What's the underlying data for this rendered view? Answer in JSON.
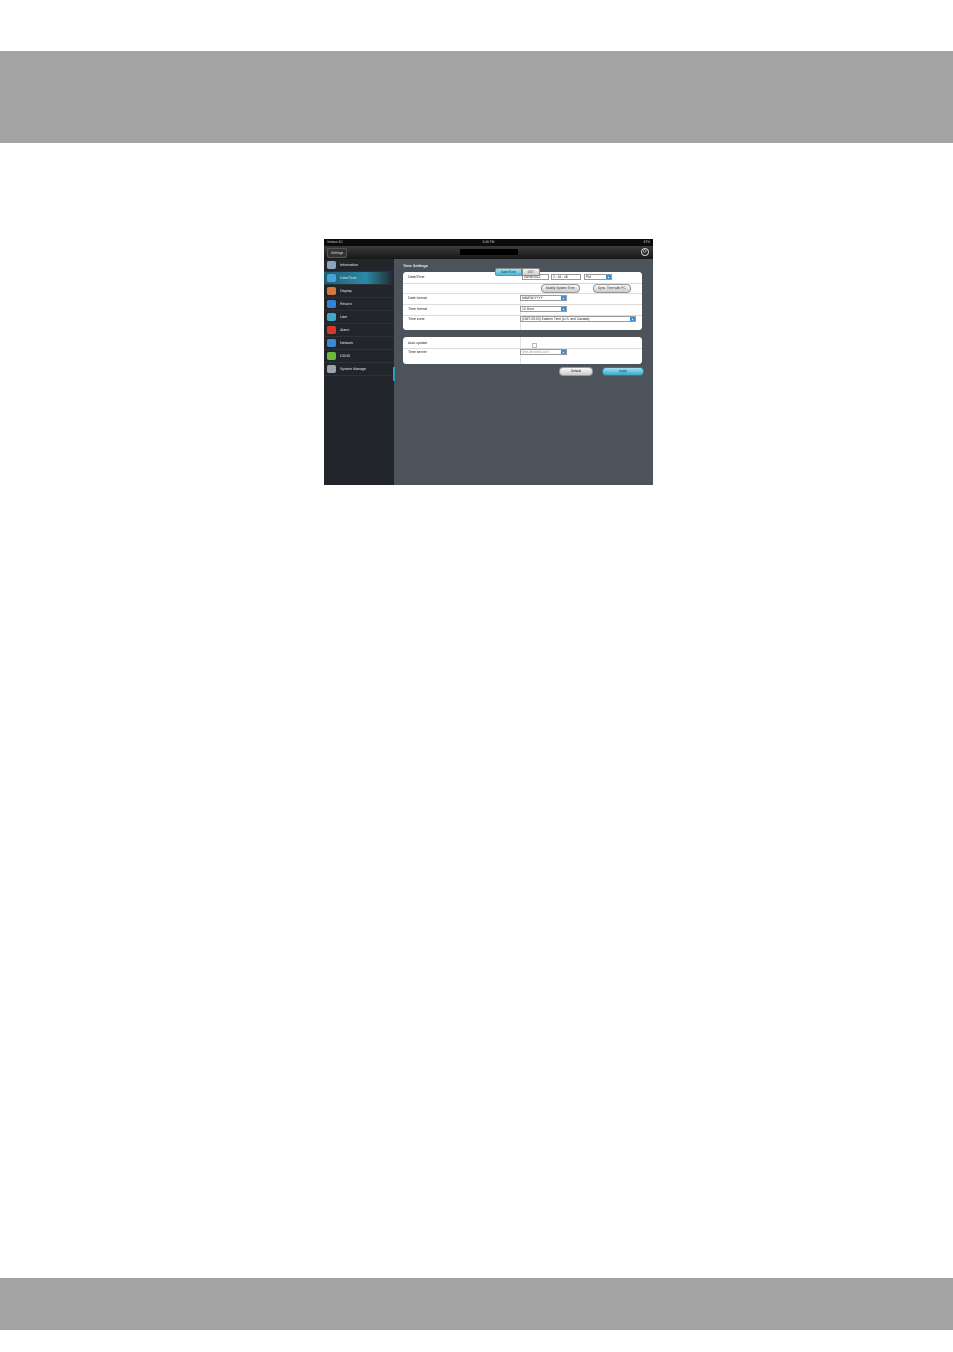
{
  "status_bar": {
    "left": "Verizon 3G",
    "time": "5:36 PM",
    "right": "87%"
  },
  "nav": {
    "back_label": "Settings"
  },
  "sidebar": {
    "items": [
      {
        "label": "Information",
        "icon": "info-icon",
        "color": "#8aa4b8"
      },
      {
        "label": "Date/Time",
        "icon": "calendar-clock-icon",
        "color": "#4aa3d6"
      },
      {
        "label": "Display",
        "icon": "display-icon",
        "color": "#d27a3a"
      },
      {
        "label": "Record",
        "icon": "record-icon",
        "color": "#3a7fd6"
      },
      {
        "label": "User",
        "icon": "user-icon",
        "color": "#3fa7c9"
      },
      {
        "label": "Alarm",
        "icon": "alarm-icon",
        "color": "#d43a2a"
      },
      {
        "label": "Network",
        "icon": "network-icon",
        "color": "#3a8ad6"
      },
      {
        "label": "DDNS",
        "icon": "ddns-icon",
        "color": "#6ab93a"
      },
      {
        "label": "System Manage",
        "icon": "system-manage-icon",
        "color": "#9aa2aa"
      }
    ]
  },
  "main": {
    "section_title": "Time Settings",
    "tabs": [
      "Date/Time",
      "DST"
    ],
    "rows": {
      "datetime_label": "Date/Time",
      "date_value": "05/05/2012",
      "time_value": "2 : 34 : 48",
      "ampm_value": "PM",
      "modify_button": "Modify System Time",
      "sync_button": "Sync. Time with PC",
      "date_format_label": "Date format",
      "date_format_value": "MM/DD/YYYY",
      "time_format_label": "Time format",
      "time_format_value": "12-Hour",
      "time_zone_label": "Time zone",
      "time_zone_value": "(GMT-05:00) Eastern Time (U.S. and Canada)",
      "auto_update_label": "Auto update",
      "time_server_label": "Time server",
      "time_server_placeholder": "time.windows.com"
    },
    "buttons": {
      "default": "Default",
      "apply": "Apply"
    }
  }
}
